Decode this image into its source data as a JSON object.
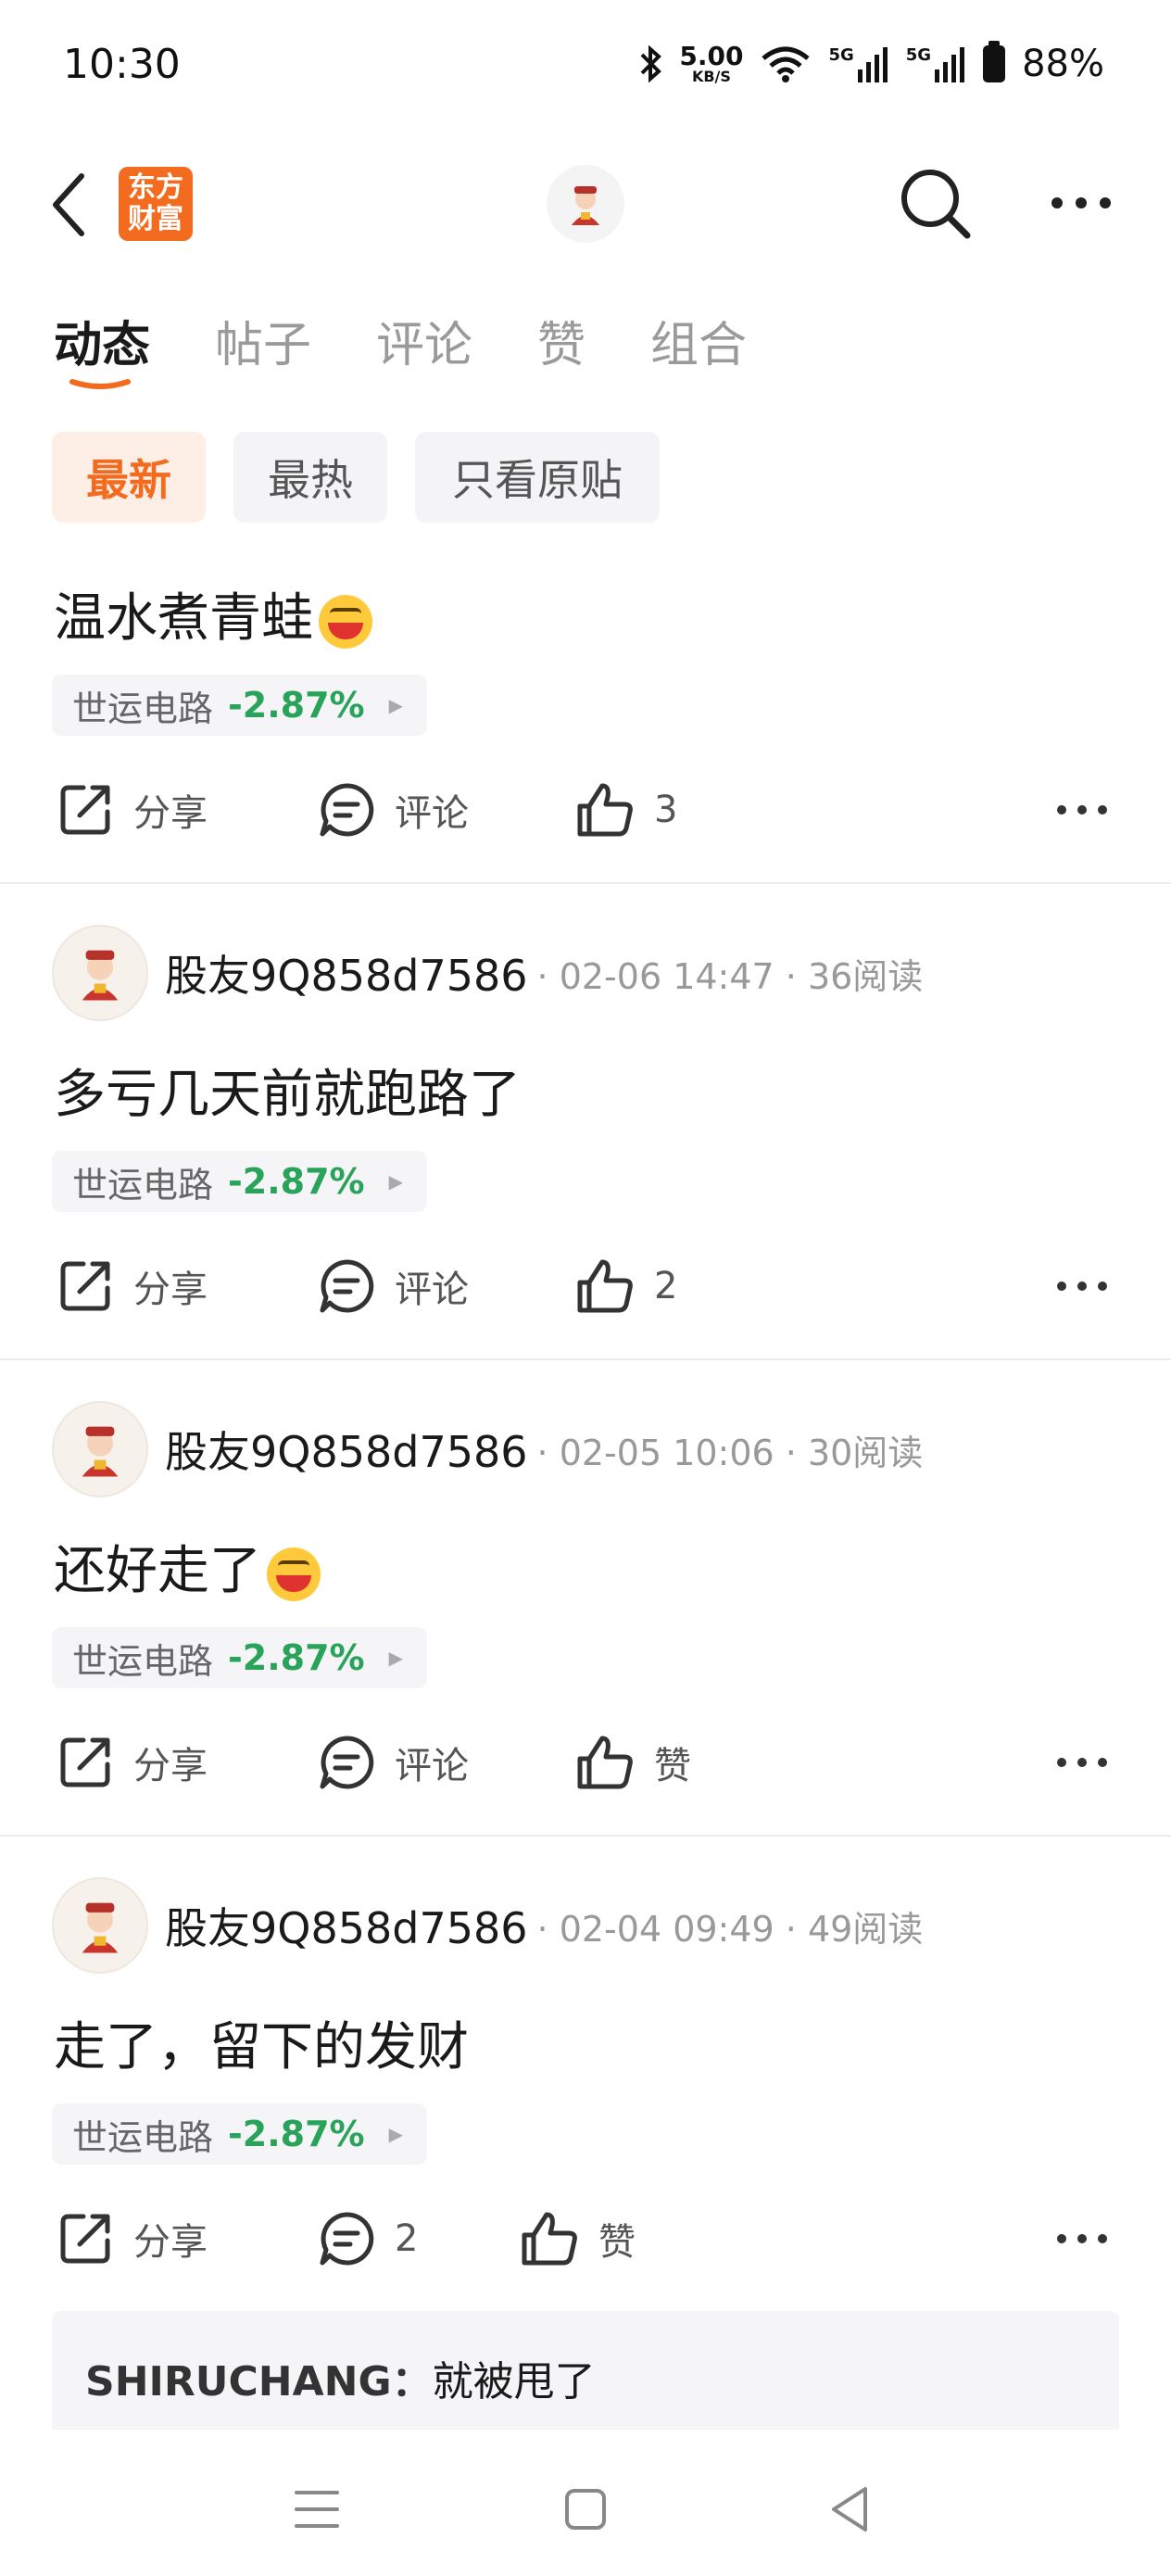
{
  "status_bar": {
    "time": "10:30",
    "net_speed_value": "5.00",
    "net_speed_unit": "KB/S",
    "signal1": "5G",
    "signal2": "5G",
    "battery": "88%"
  },
  "header": {
    "logo_line1": "东方",
    "logo_line2": "财富",
    "icons": [
      "back-icon",
      "search-icon",
      "more-icon"
    ]
  },
  "tabs": [
    {
      "label": "动态",
      "active": true
    },
    {
      "label": "帖子",
      "active": false
    },
    {
      "label": "评论",
      "active": false
    },
    {
      "label": "赞",
      "active": false
    },
    {
      "label": "组合",
      "active": false
    }
  ],
  "filters": [
    {
      "label": "最新",
      "active": true
    },
    {
      "label": "最热",
      "active": false
    },
    {
      "label": "只看原贴",
      "active": false
    }
  ],
  "colors": {
    "brand": "#f26b1f",
    "stock_down": "#2aa35a",
    "text_primary": "#1a1a1a",
    "text_secondary": "#999999"
  },
  "posts": [
    {
      "text": "温水煮青蛙",
      "stock": {
        "name": "世运电路",
        "change": "-2.87%"
      },
      "share_label": "分享",
      "comment_label": "评论",
      "like_label": "3"
    },
    {
      "author": "股友9Q858d7586",
      "meta": "· 02-06 14:47 · 36阅读",
      "text": "多亏几天前就跑路了",
      "stock": {
        "name": "世运电路",
        "change": "-2.87%"
      },
      "share_label": "分享",
      "comment_label": "评论",
      "like_label": "2"
    },
    {
      "author": "股友9Q858d7586",
      "meta": "· 02-05 10:06 · 30阅读",
      "text": "还好走了",
      "stock": {
        "name": "世运电路",
        "change": "-2.87%"
      },
      "share_label": "分享",
      "comment_label": "评论",
      "like_label": "赞"
    },
    {
      "author": "股友9Q858d7586",
      "meta": "· 02-04 09:49 · 49阅读",
      "text": "走了，留下的发财",
      "stock": {
        "name": "世运电路",
        "change": "-2.87%"
      },
      "share_label": "分享",
      "comment_label": "2",
      "like_label": "赞",
      "reply": {
        "author": "SHIRUCHANG：",
        "text": "就被甩了"
      }
    }
  ]
}
